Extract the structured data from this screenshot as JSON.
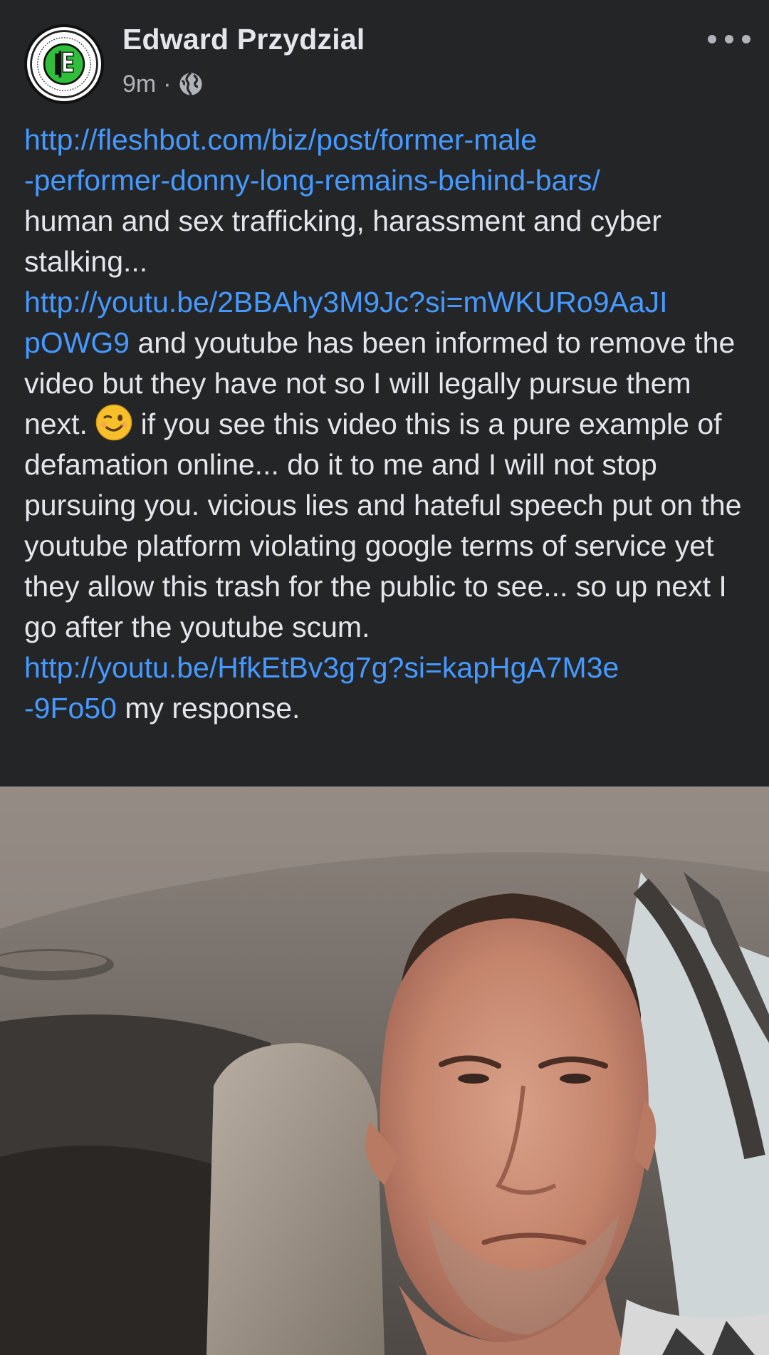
{
  "post": {
    "author": "Edward Przydzial",
    "timestamp": "9m",
    "separator": "·",
    "audience_icon": "globe-icon",
    "more_icon": "more-options-icon",
    "link1": "http://fleshbot.com/biz/post/former-male\n-performer-donny-long-remains-behind-bars/",
    "text1": "\nhuman and sex trafficking, harassment and cyber stalking...\n",
    "link2": "http://youtu.be/2BBAhy3M9Jc?si=mWKURo9AaJI\npOWG9",
    "text2": " and youtube has been informed to remove the video but they have not so I will legally pursue them next. ",
    "emoji": "winking-face-emoji",
    "text3": " if you see this video this is a pure example of defamation online... do it to me and I will not stop pursuing you. vicious lies and hateful speech put on the youtube platform violating google terms of service yet they allow this trash for the public to see... so up next I go after the youtube scum.\n",
    "link3": "http://youtu.be/HfkEtBv3g7g?si=kapHgA7M3e\n-9Fo50",
    "text4": " my response."
  },
  "colors": {
    "background": "#242526",
    "text": "#e4e6eb",
    "secondary_text": "#b0b3b8",
    "link": "#4599ff",
    "avatar_accent": "#2fbf3a"
  }
}
